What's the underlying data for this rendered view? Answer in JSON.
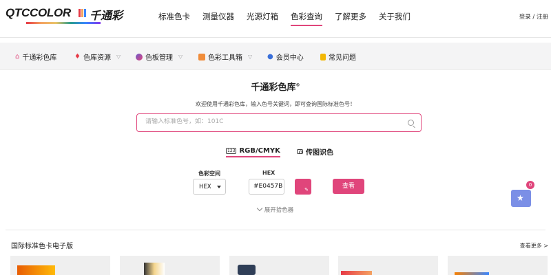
{
  "header": {
    "logo_text": "QTCCOLOR",
    "logo_cn": "千通彩",
    "nav": [
      {
        "label": "标准色卡"
      },
      {
        "label": "测量仪器"
      },
      {
        "label": "光源灯箱"
      },
      {
        "label": "色彩查询",
        "active": true
      },
      {
        "label": "了解更多"
      },
      {
        "label": "关于我们"
      }
    ],
    "login_label": "登录 / 注册"
  },
  "subnav": {
    "items": [
      {
        "label": "千通彩色库",
        "icon": "home-icon",
        "color": "#e0457b"
      },
      {
        "label": "色库资源",
        "icon": "flame-icon",
        "color": "#e63946",
        "dropdown": true
      },
      {
        "label": "色板管理",
        "icon": "palette-icon",
        "color": "#6a5acd",
        "dropdown": true
      },
      {
        "label": "色彩工具箱",
        "icon": "toolbox-icon",
        "color": "#f08c3a",
        "dropdown": true
      },
      {
        "label": "会员中心",
        "icon": "user-icon",
        "color": "#3a6fd9"
      },
      {
        "label": "常见问题",
        "icon": "document-icon",
        "color": "#f2b705"
      }
    ]
  },
  "main": {
    "title": "千通彩色库",
    "title_mark": "®",
    "subtitle": "欢迎使用千通彩色库，输入色号关键词，即可查询国际标准色号！",
    "search_placeholder": "请输入标准色号，如：101C",
    "tabs": [
      {
        "label": "RGB/CMYK",
        "badge": "123",
        "active": true
      },
      {
        "label": "传图识色"
      }
    ],
    "color_space_label": "色彩空间",
    "color_space_value": "HEX",
    "hex_label": "HEX",
    "hex_value": "#E0457B",
    "swatch_color": "#E0457B",
    "view_button": "查看",
    "expand_label": "展开拾色器",
    "favorites_count": "0"
  },
  "section": {
    "title": "国际标准色卡电子版",
    "see_more": "查看更多 >"
  },
  "colors": {
    "accent": "#e0457b",
    "fav_button": "#7b8fe6"
  }
}
